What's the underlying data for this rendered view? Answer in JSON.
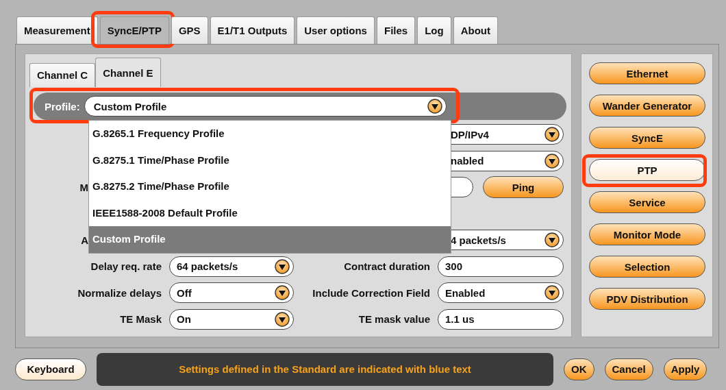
{
  "tabs": [
    {
      "label": "Measurement",
      "selected": false,
      "highlighted": false
    },
    {
      "label": "SyncE/PTP",
      "selected": true,
      "highlighted": true
    },
    {
      "label": "GPS",
      "selected": false,
      "highlighted": false
    },
    {
      "label": "E1/T1 Outputs",
      "selected": false,
      "highlighted": false
    },
    {
      "label": "User options",
      "selected": false,
      "highlighted": false
    },
    {
      "label": "Files",
      "selected": false,
      "highlighted": false
    },
    {
      "label": "Log",
      "selected": false,
      "highlighted": false
    },
    {
      "label": "About",
      "selected": false,
      "highlighted": false
    }
  ],
  "channel_tabs": [
    {
      "label": "Channel C",
      "selected": false
    },
    {
      "label": "Channel E",
      "selected": true
    }
  ],
  "profile": {
    "label": "Profile:",
    "value": "Custom Profile",
    "highlighted": true,
    "options": [
      {
        "label": "G.8265.1 Frequency Profile",
        "selected": false
      },
      {
        "label": "G.8275.1 Time/Phase Profile",
        "selected": false
      },
      {
        "label": "G.8275.2 Time/Phase Profile",
        "selected": false
      },
      {
        "label": "IEEE1588-2008 Default Profile",
        "selected": false
      },
      {
        "label": "Custom Profile",
        "selected": true
      }
    ]
  },
  "form": {
    "top_rows": [
      {
        "right": {
          "kind": "select",
          "value": "DP/IPv4",
          "cut": true
        }
      },
      {
        "right": {
          "kind": "select",
          "value": "nabled",
          "cut": true
        }
      },
      {
        "left": {
          "label": "M",
          "cut": true
        },
        "right": {
          "kind": "text_with_button",
          "button": "Ping"
        }
      }
    ],
    "bottom_rows": [
      {
        "left": {
          "label": "A",
          "cut": true
        },
        "right": {
          "kind": "select",
          "value": "4 packets/s",
          "cut": true
        }
      },
      {
        "left": {
          "label": "Delay req. rate",
          "kind": "select",
          "value": "64 packets/s"
        },
        "right": {
          "label": "Contract duration",
          "kind": "text",
          "value": "300"
        }
      },
      {
        "left": {
          "label": "Normalize delays",
          "kind": "select",
          "value": "Off"
        },
        "right": {
          "label": "Include Correction Field",
          "kind": "select",
          "value": "Enabled"
        }
      },
      {
        "left": {
          "label": "TE Mask",
          "kind": "select",
          "value": "On"
        },
        "right": {
          "label": "TE mask value",
          "kind": "text",
          "value": "1.1 us"
        }
      }
    ]
  },
  "side_buttons": [
    {
      "label": "Ethernet",
      "selected": false,
      "highlighted": false
    },
    {
      "label": "Wander Generator",
      "selected": false,
      "highlighted": false
    },
    {
      "label": "SyncE",
      "selected": false,
      "highlighted": false
    },
    {
      "label": "PTP",
      "selected": true,
      "highlighted": true
    },
    {
      "label": "Service",
      "selected": false,
      "highlighted": false
    },
    {
      "label": "Monitor Mode",
      "selected": false,
      "highlighted": false
    },
    {
      "label": "Selection",
      "selected": false,
      "highlighted": false
    },
    {
      "label": "PDV Distribution",
      "selected": false,
      "highlighted": false
    }
  ],
  "bottom_bar": {
    "keyboard_button": "Keyboard",
    "message": "Settings defined in the Standard are indicated with blue text",
    "buttons": [
      "OK",
      "Cancel",
      "Apply"
    ]
  }
}
